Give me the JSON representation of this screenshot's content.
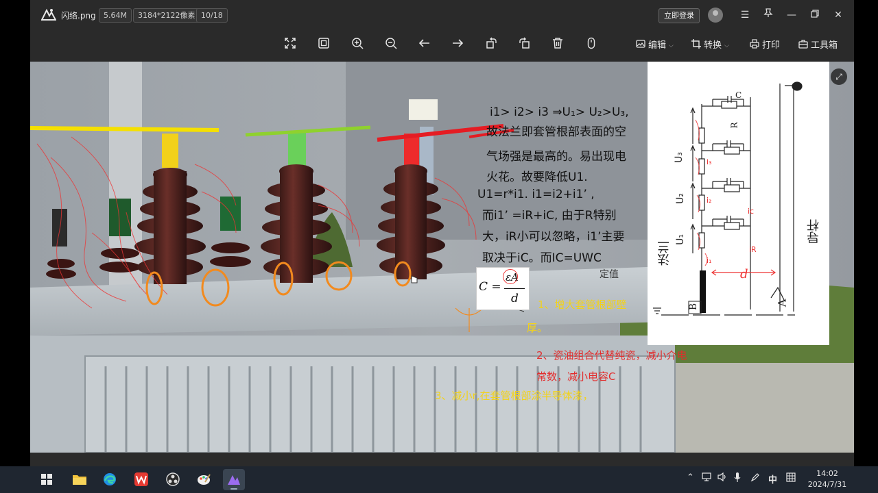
{
  "titlebar": {
    "filename": "闪络.png",
    "filesize": "5.64M",
    "dimensions": "3184*2122像素",
    "counter": "10/18",
    "login_label": "立即登录"
  },
  "toolbar": {
    "edit_label": "编辑",
    "convert_label": "转换",
    "print_label": "打印",
    "toolbox_label": "工具箱"
  },
  "annotations": {
    "line1": "i1> i2> i3 ⇒U₁> U₂>U₃,",
    "line2": "故法兰即套管根部表面的空",
    "line3": "气场强是最高的。易出现电",
    "line4": "火花。故要降低U1.",
    "line5": "U1=r*i1.  i1=i2+i1’ ,",
    "line6": "而i1’ =iR+iC, 由于R特别",
    "line7": "大，iR小可以忽略，i1’主要",
    "line8": "取决于iC。而IC=UWC",
    "handwritten_note": "定值",
    "formula_c": "C =",
    "formula_num": "εA",
    "formula_den": "d",
    "point1a": "1、增大套管根部壁",
    "point1b": "厚。",
    "point2a": "2、瓷油组合代替纯瓷，减小介电",
    "point2b": "常数，减小电容C",
    "point3": "3、减小r,在套管根部涂半导体漆，"
  },
  "diagram": {
    "label_c": "C",
    "label_r": "R",
    "label_u3": "U₃",
    "label_u2": "U₂",
    "label_u1": "U₁",
    "label_i3": "i₃",
    "label_i2": "i₂",
    "label_i1": "i₁",
    "label_ic": "ic",
    "label_ir": "iR",
    "label_d": "d",
    "label_flange": "法兰",
    "label_rod": "导杆",
    "label_a": "A",
    "label_b": "B"
  },
  "taskbar": {
    "tray_ime": "中",
    "time": "14:02",
    "date": "2024/7/31"
  },
  "colors": {
    "window_bg": "#2a2a2a",
    "taskbar_bg": "#1f2630",
    "annotation_yellow": "#f2d21a",
    "annotation_red": "#e22d2d",
    "bar_yellow": "#f5e000",
    "bar_green": "#8fd12e",
    "bar_red": "#e51c23"
  }
}
